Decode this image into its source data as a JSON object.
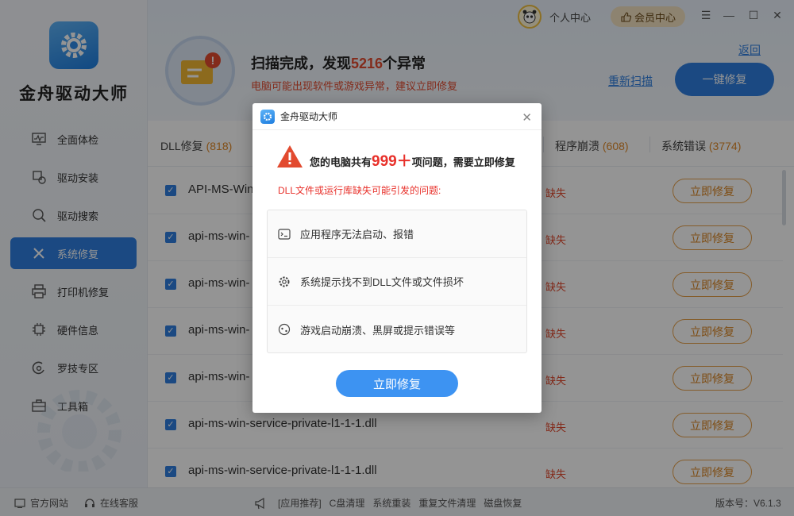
{
  "app": {
    "name": "金舟驱动大师",
    "version": "版本号：V6.1.3"
  },
  "titlebar": {
    "user_center": "个人中心",
    "vip_center": "会员中心"
  },
  "sidebar": {
    "items": [
      {
        "label": "全面体检",
        "icon": "monitor-icon"
      },
      {
        "label": "驱动安装",
        "icon": "driver-install-icon"
      },
      {
        "label": "驱动搜索",
        "icon": "driver-search-icon"
      },
      {
        "label": "系统修复",
        "icon": "wrench-icon",
        "active": true
      },
      {
        "label": "打印机修复",
        "icon": "printer-icon"
      },
      {
        "label": "硬件信息",
        "icon": "chip-icon"
      },
      {
        "label": "罗技专区",
        "icon": "logitech-icon"
      },
      {
        "label": "工具箱",
        "icon": "toolbox-icon"
      }
    ]
  },
  "header": {
    "title_prefix": "扫描完成，发现",
    "title_count": "5216",
    "title_suffix": "个异常",
    "subtitle": "电脑可能出现软件或游戏异常，建议立即修复",
    "back": "返回",
    "rescan": "重新扫描",
    "fix_all": "一键修复"
  },
  "tabs": [
    {
      "label": "DLL修复",
      "count": "(818)"
    },
    {
      "label": "程序崩溃",
      "count": "(608)"
    },
    {
      "label": "系统错误",
      "count": "(3774)"
    }
  ],
  "rows": [
    {
      "name": "API-MS-Win",
      "status": "缺失",
      "action": "立即修复"
    },
    {
      "name": "api-ms-win-",
      "status": "缺失",
      "action": "立即修复"
    },
    {
      "name": "api-ms-win-",
      "status": "缺失",
      "action": "立即修复"
    },
    {
      "name": "api-ms-win-",
      "status": "缺失",
      "action": "立即修复"
    },
    {
      "name": "api-ms-win-",
      "status": "缺失",
      "action": "立即修复"
    },
    {
      "name": "api-ms-win-service-private-l1-1-1.dll",
      "status": "缺失",
      "action": "立即修复"
    },
    {
      "name": "api-ms-win-service-private-l1-1-1.dll",
      "status": "缺失",
      "action": "立即修复"
    }
  ],
  "footer": {
    "official_site": "官方网站",
    "online_service": "在线客服",
    "recommend": "[应用推荐]",
    "links": [
      "C盘清理",
      "系统重装",
      "重复文件清理",
      "磁盘恢复"
    ]
  },
  "dialog": {
    "title": "金舟驱动大师",
    "headline_prefix": "您的电脑共有",
    "headline_count": "999＋",
    "headline_suffix": "项问题，需要立即修复",
    "cause": "DLL文件或运行库缺失可能引发的问题:",
    "problems": [
      {
        "text": "应用程序无法启动、报错",
        "icon": "terminal-icon"
      },
      {
        "text": "系统提示找不到DLL文件或文件损坏",
        "icon": "gear-icon"
      },
      {
        "text": "游戏启动崩溃、黑屏或提示错误等",
        "icon": "gamepad-icon"
      }
    ],
    "fix_button": "立即修复"
  },
  "colors": {
    "accent": "#2f7fe0",
    "danger": "#e8302a",
    "warning": "#e08a2a"
  }
}
